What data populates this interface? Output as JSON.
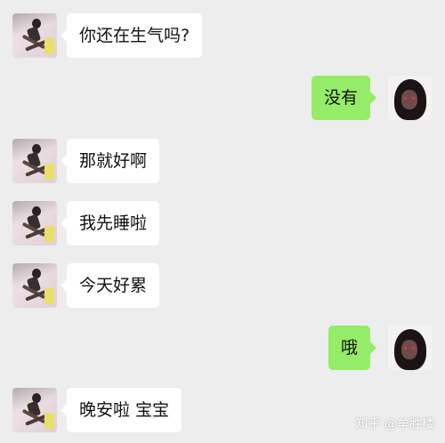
{
  "conversation": {
    "messages": [
      {
        "side": "incoming",
        "text": "你还在生气吗?"
      },
      {
        "side": "outgoing",
        "text": "没有"
      },
      {
        "side": "incoming",
        "text": "那就好啊"
      },
      {
        "side": "incoming",
        "text": "我先睡啦"
      },
      {
        "side": "incoming",
        "text": "今天好累"
      },
      {
        "side": "outgoing",
        "text": "哦"
      },
      {
        "side": "incoming",
        "text": "晚安啦 宝宝"
      }
    ]
  },
  "watermark": {
    "text": "知乎 @牟胜楼"
  },
  "colors": {
    "background": "#ededed",
    "incoming_bubble": "#ffffff",
    "outgoing_bubble": "#95ec69"
  }
}
